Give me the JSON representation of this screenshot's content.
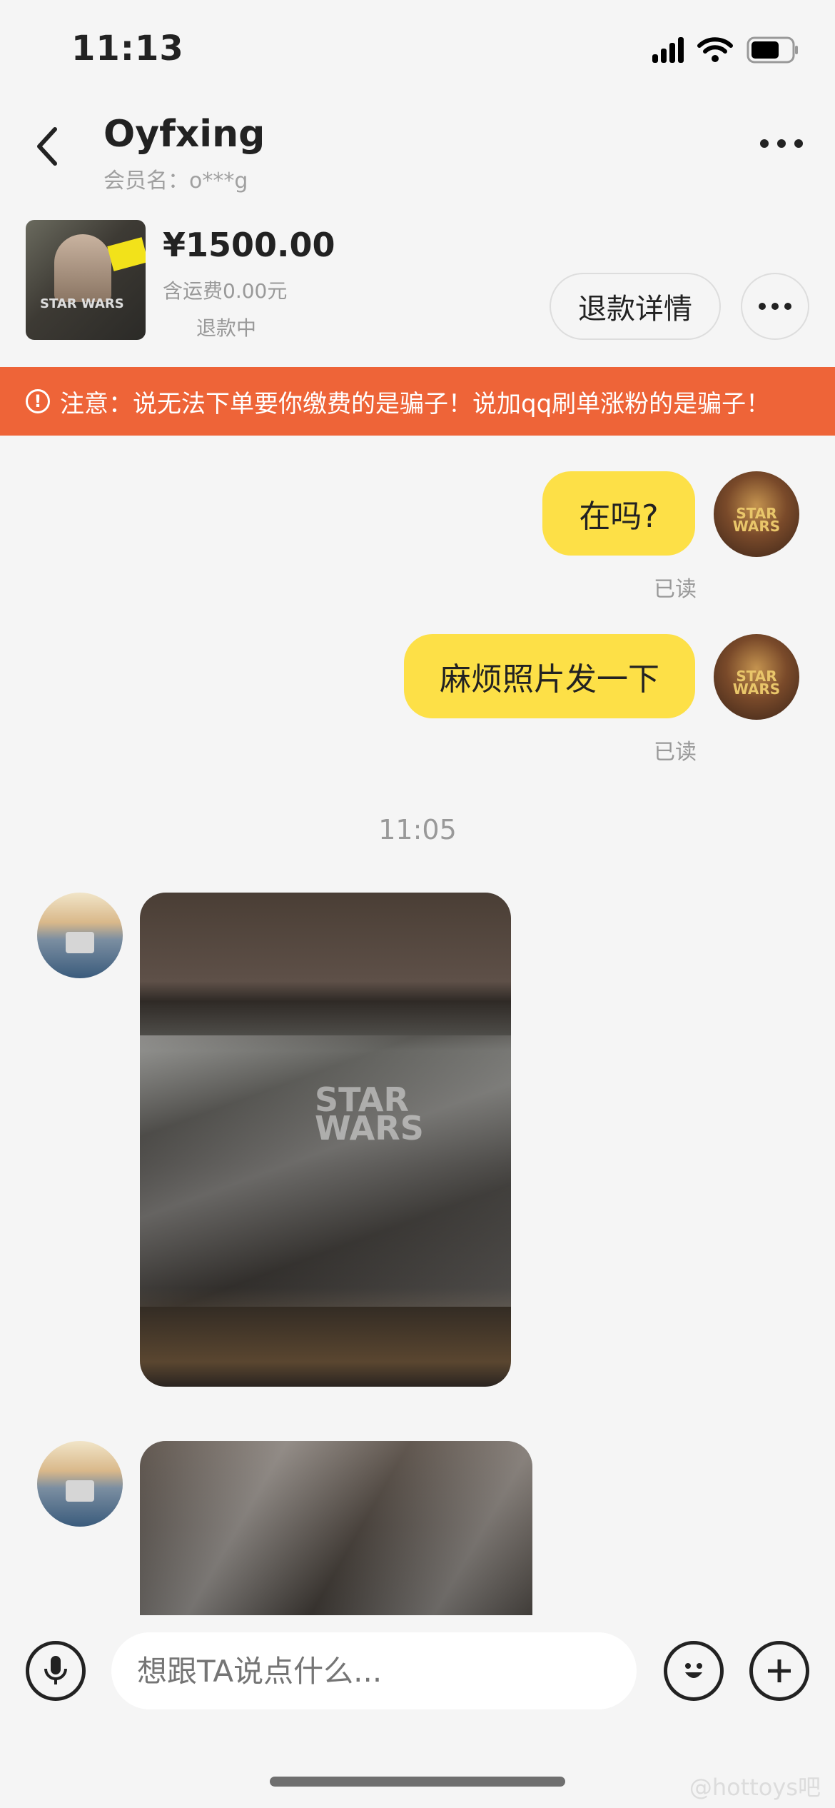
{
  "status_bar": {
    "time": "11:13"
  },
  "header": {
    "contact_name": "Oyfxing",
    "member_label": "会员名：o***g"
  },
  "product": {
    "price": "¥1500.00",
    "shipping": "含运费0.00元",
    "status": "退款中",
    "refund_button_label": "退款详情"
  },
  "warning": {
    "text": "注意：说无法下单要你缴费的是骗子！说加qq刷单涨粉的是骗子！"
  },
  "messages": [
    {
      "side": "right",
      "text": "在吗?",
      "status": "已读"
    },
    {
      "side": "right",
      "text": "麻烦照片发一下",
      "status": "已读"
    }
  ],
  "timestamp": "11:05",
  "input": {
    "placeholder": "想跟TA说点什么..."
  },
  "watermark": "@hottoys吧"
}
